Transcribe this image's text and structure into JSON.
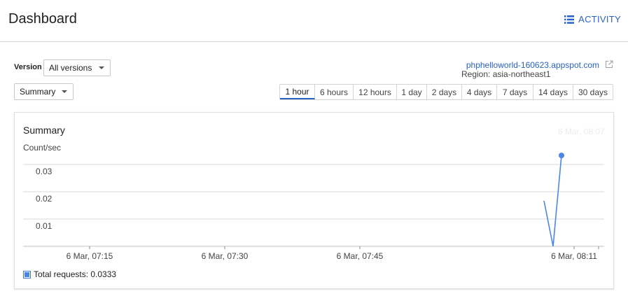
{
  "header": {
    "title": "Dashboard",
    "activity_label": "ACTIVITY"
  },
  "controls": {
    "version_label": "Version",
    "version_value": "All versions",
    "view_value": "Summary",
    "app_link": "phphelloworld-160623.appspot.com",
    "region": "Region: asia-northeast1",
    "time_ranges": [
      "1 hour",
      "6 hours",
      "12 hours",
      "1 day",
      "2 days",
      "4 days",
      "7 days",
      "14 days",
      "30 days"
    ],
    "active_range": "1 hour"
  },
  "colors": {
    "accent": "#2a62c6",
    "series": "#4a86e8"
  },
  "chart_data": {
    "type": "line",
    "title": "Summary",
    "hover_time": "6 Mar, 08:07",
    "ylabel": "Count/sec",
    "ylim": [
      0,
      0.03
    ],
    "yticks": [
      0.01,
      0.02,
      0.03
    ],
    "ytick_labels": [
      "0.01",
      "0.02",
      "0.03"
    ],
    "xticks": [
      "6 Mar, 07:15",
      "6 Mar, 07:30",
      "6 Mar, 07:45",
      "6 Mar, 08:11"
    ],
    "grid": true,
    "legend_position": "bottom-left",
    "series": [
      {
        "name": "Total requests: 0.0333",
        "x": [
          "6 Mar, 08:07",
          "6 Mar, 08:08",
          "6 Mar, 08:09"
        ],
        "values": [
          0.0167,
          0,
          0.0333
        ]
      }
    ]
  }
}
